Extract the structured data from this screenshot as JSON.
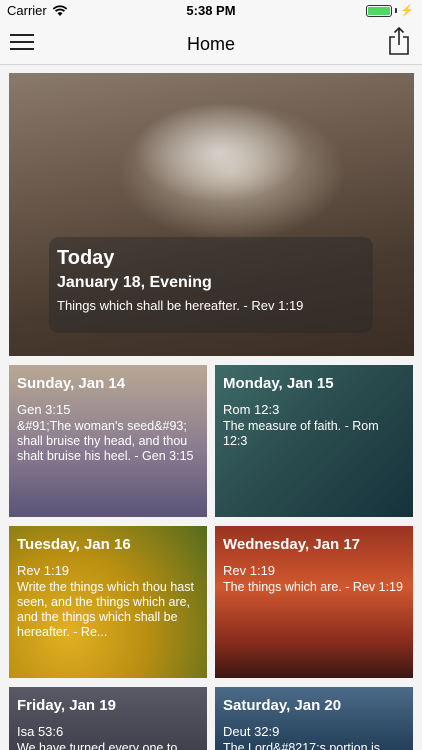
{
  "status": {
    "carrier": "Carrier",
    "time": "5:38 PM"
  },
  "nav": {
    "title": "Home"
  },
  "hero": {
    "label": "Today",
    "date": "January 18, Evening",
    "text": "Things which shall be hereafter. - Rev 1:19"
  },
  "cards": [
    {
      "date": "Sunday, Jan 14",
      "ref": "Gen 3:15",
      "text": "&#91;The woman's seed&#93; shall bruise thy head, and thou shalt bruise his heel. - Gen 3:15"
    },
    {
      "date": "Monday, Jan 15",
      "ref": "Rom 12:3",
      "text": "The measure of faith. - Rom 12:3"
    },
    {
      "date": "Tuesday, Jan 16",
      "ref": "Rev 1:19",
      "text": "Write the things which thou hast seen, and the things which are, and the things which shall be hereafter. - Re..."
    },
    {
      "date": "Wednesday, Jan 17",
      "ref": "Rev 1:19",
      "text": "The things which are. - Rev 1:19"
    },
    {
      "date": "Friday, Jan 19",
      "ref": "Isa 53:6",
      "text": "We have turned every one to"
    },
    {
      "date": "Saturday, Jan 20",
      "ref": "Deut 32:9",
      "text": "The Lord&#8217;s portion is"
    }
  ],
  "colors": {
    "battery": "#4cd964",
    "navBackground": "#f7f7f7"
  },
  "icons": {
    "menu": "hamburger-menu-icon",
    "share": "share-icon",
    "wifi": "wifi-icon",
    "battery": "battery-icon"
  }
}
